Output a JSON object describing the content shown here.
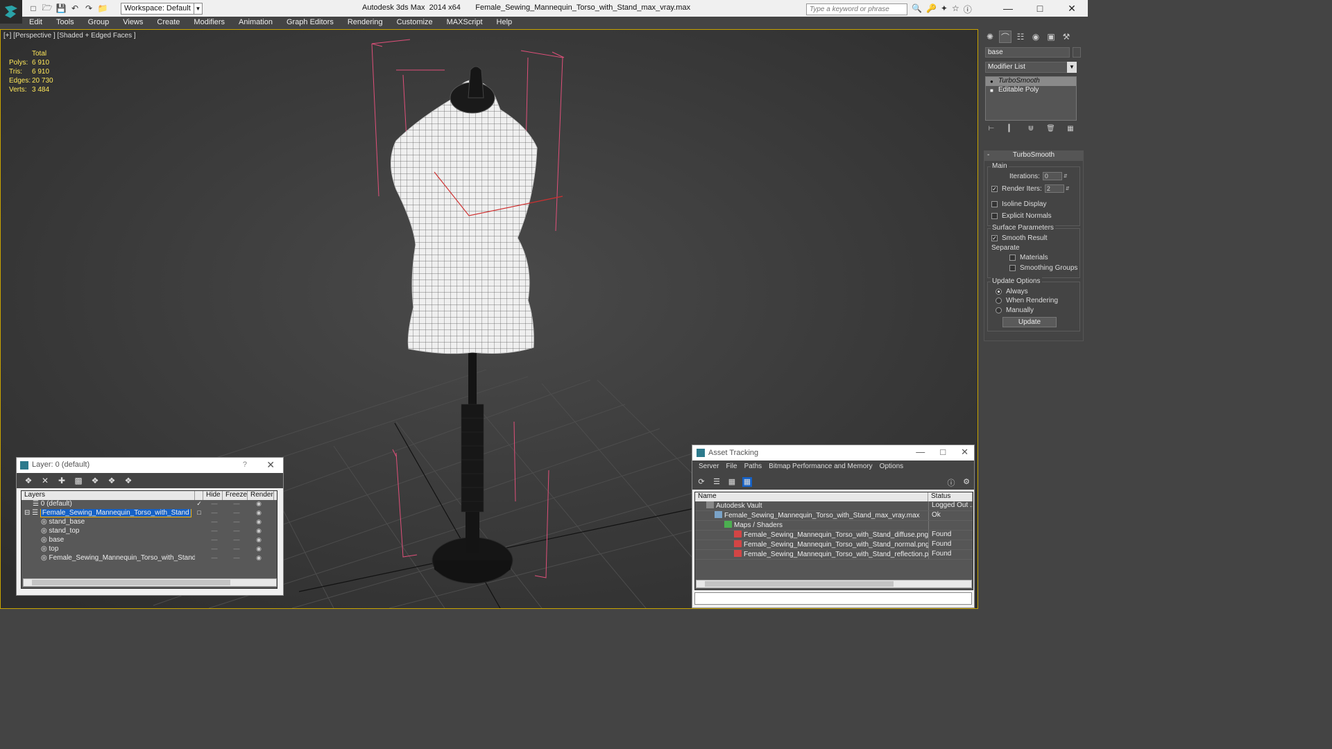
{
  "titlebar": {
    "workspace": "Workspace: Default",
    "app_title": "Autodesk 3ds Max  2014 x64",
    "file_title": "Female_Sewing_Mannequin_Torso_with_Stand_max_vray.max",
    "search_placeholder": "Type a keyword or phrase"
  },
  "menu": [
    "Edit",
    "Tools",
    "Group",
    "Views",
    "Create",
    "Modifiers",
    "Animation",
    "Graph Editors",
    "Rendering",
    "Customize",
    "MAXScript",
    "Help"
  ],
  "viewport": {
    "label": "[+] [Perspective ] [Shaded + Edged Faces ]",
    "stats": {
      "header": "Total",
      "rows": [
        {
          "k": "Polys:",
          "v": "6 910"
        },
        {
          "k": "Tris:",
          "v": "6 910"
        },
        {
          "k": "Edges:",
          "v": "20 730"
        },
        {
          "k": "Verts:",
          "v": "3 484"
        }
      ]
    }
  },
  "command_panel": {
    "object_name": "base",
    "modifier_list": "Modifier List",
    "stack": [
      "TurboSmooth",
      "Editable Poly"
    ],
    "rollout_title": "TurboSmooth",
    "main_group": "Main",
    "iterations_label": "Iterations:",
    "iterations_value": "0",
    "render_iters_label": "Render Iters:",
    "render_iters_value": "2",
    "isoline_display": "Isoline Display",
    "explicit_normals": "Explicit Normals",
    "surface_group": "Surface Parameters",
    "smooth_result": "Smooth Result",
    "separate": "Separate",
    "materials": "Materials",
    "smoothing_groups": "Smoothing Groups",
    "update_group": "Update Options",
    "always": "Always",
    "when_rendering": "When Rendering",
    "manually": "Manually",
    "update_button": "Update"
  },
  "layer_window": {
    "title": "Layer: 0 (default)",
    "help": "?",
    "columns": [
      "Layers",
      "Hide",
      "Freeze",
      "Render"
    ],
    "rows": [
      {
        "name": "0 (default)",
        "indent": 1
      },
      {
        "name": "Female_Sewing_Mannequin_Torso_with_Stand",
        "indent": 0
      },
      {
        "name": "stand_base",
        "indent": 2
      },
      {
        "name": "stand_top",
        "indent": 2
      },
      {
        "name": "base",
        "indent": 2
      },
      {
        "name": "top",
        "indent": 2
      },
      {
        "name": "Female_Sewing_Mannequin_Torso_with_Stand",
        "indent": 2
      }
    ]
  },
  "asset_window": {
    "title": "Asset Tracking",
    "menu": [
      "Server",
      "File",
      "Paths",
      "Bitmap Performance and Memory",
      "Options"
    ],
    "columns": [
      "Name",
      "Status"
    ],
    "rows": [
      {
        "name": "Autodesk Vault",
        "status": "Logged Out ...",
        "indent": 1
      },
      {
        "name": "Female_Sewing_Mannequin_Torso_with_Stand_max_vray.max",
        "status": "Ok",
        "indent": 2
      },
      {
        "name": "Maps / Shaders",
        "status": "",
        "indent": 3
      },
      {
        "name": "Female_Sewing_Mannequin_Torso_with_Stand_diffuse.png",
        "status": "Found",
        "indent": 4
      },
      {
        "name": "Female_Sewing_Mannequin_Torso_with_Stand_normal.png",
        "status": "Found",
        "indent": 4
      },
      {
        "name": "Female_Sewing_Mannequin_Torso_with_Stand_reflection.png",
        "status": "Found",
        "indent": 4
      }
    ]
  },
  "colors": {
    "viewport_border": "#c9a400",
    "stats": "#ffe85a",
    "selection": "#1561c6",
    "bbox": "#e0507a"
  }
}
